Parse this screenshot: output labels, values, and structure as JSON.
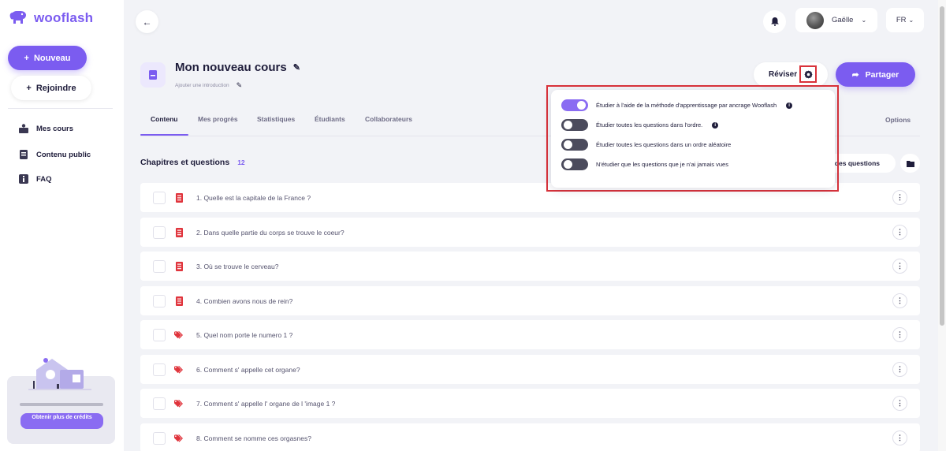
{
  "app": {
    "logo_text": "wooflash",
    "brand_color": "#7b5cf0"
  },
  "sidebar": {
    "new_button": "Nouveau",
    "join_button": "Rejoindre",
    "items": [
      {
        "label": "Mes cours",
        "icon": "courses-icon"
      },
      {
        "label": "Contenu public",
        "icon": "public-content-icon"
      },
      {
        "label": "FAQ",
        "icon": "info-icon"
      }
    ],
    "promo_button": "Obtenir plus de crédits"
  },
  "topbar": {
    "user_name": "Gaëlle",
    "language": "FR"
  },
  "course": {
    "title": "Mon nouveau cours",
    "intro_placeholder": "Ajouter une introduction",
    "review_button": "Réviser",
    "share_button": "Partager"
  },
  "tabs": [
    "Contenu",
    "Mes progrès",
    "Statistiques",
    "Étudiants",
    "Collaborateurs"
  ],
  "options_tab": "Options",
  "section": {
    "title": "Chapitres et questions",
    "count": "12",
    "questions_button": "des questions"
  },
  "questions": [
    {
      "text": "1. Quelle est la capitale de la France ?",
      "icon": "list-icon"
    },
    {
      "text": "2. Dans quelle partie du corps se trouve le coeur?",
      "icon": "list-icon"
    },
    {
      "text": "3. Où se trouve le cerveau?",
      "icon": "list-icon"
    },
    {
      "text": "4. Combien avons nous de rein?",
      "icon": "list-icon"
    },
    {
      "text": "5. Quel nom porte le numero 1 ?",
      "icon": "tag-icon"
    },
    {
      "text": "6. Comment s' appelle cet organe?",
      "icon": "tag-icon"
    },
    {
      "text": "7. Comment s' appelle l' organe de l 'image 1 ?",
      "icon": "tag-icon"
    },
    {
      "text": "8. Comment se nomme ces orgasnes?",
      "icon": "tag-icon"
    }
  ],
  "settings_popup": {
    "options": [
      {
        "label": "Étudier à l'aide de la méthode d'apprentissage par ancrage Wooflash",
        "enabled": true,
        "has_info": true
      },
      {
        "label": "Étudier toutes les questions dans l'ordre.",
        "enabled": false,
        "has_info": true
      },
      {
        "label": "Étudier toutes les questions dans un ordre aléatoire",
        "enabled": false,
        "has_info": false
      },
      {
        "label": "N'étudier que les questions que je n'ai jamais vues",
        "enabled": false,
        "has_info": false
      }
    ]
  }
}
